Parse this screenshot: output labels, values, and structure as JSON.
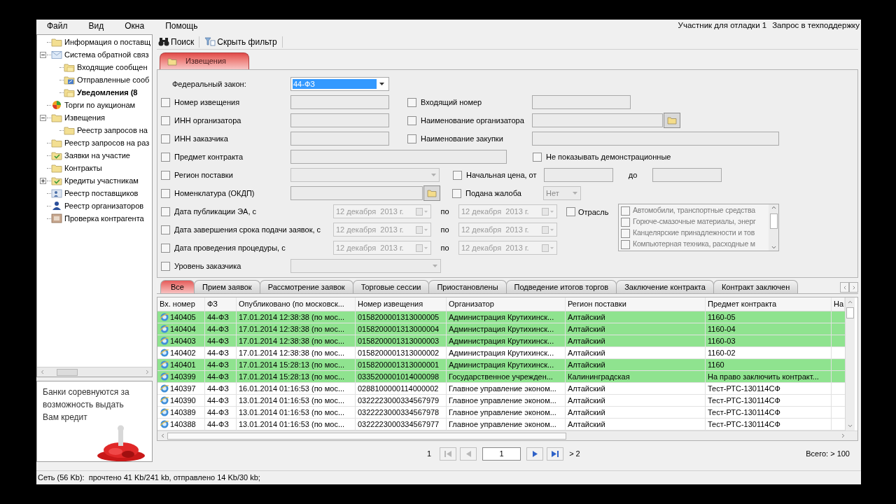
{
  "menu": [
    "Файл",
    "Вид",
    "Окна",
    "Помощь"
  ],
  "account": {
    "user": "Участник для отладки 1",
    "support": "Запрос в техподдержку"
  },
  "tree": [
    {
      "label": "Информация о поставщ",
      "kind": "folder",
      "bold": false
    },
    {
      "label": "Система обратной связ",
      "kind": "mail",
      "bold": false,
      "expanded": true,
      "children": [
        {
          "label": "Входящие сообщен",
          "kind": "mailbox",
          "bold": false
        },
        {
          "label": "Отправленные сооб",
          "kind": "outbox",
          "bold": false
        },
        {
          "label": "Уведомления (8",
          "kind": "mailbox",
          "bold": true
        }
      ]
    },
    {
      "label": "Торги по аукционам",
      "kind": "auction",
      "bold": false
    },
    {
      "label": "Извещения",
      "kind": "folder",
      "bold": false,
      "expanded": true,
      "children": [
        {
          "label": "Реестр запросов на",
          "kind": "folder",
          "bold": false
        }
      ]
    },
    {
      "label": "Реестр запросов на раз",
      "kind": "folder",
      "bold": false
    },
    {
      "label": "Заявки на участие",
      "kind": "application",
      "bold": false
    },
    {
      "label": "Контракты",
      "kind": "folder",
      "bold": false
    },
    {
      "label": "Кредиты участникам",
      "kind": "application",
      "bold": false,
      "expanded": false
    },
    {
      "label": "Реестр поставщиков",
      "kind": "suppliers",
      "bold": false
    },
    {
      "label": "Реестр организаторов",
      "kind": "organizers",
      "bold": false
    },
    {
      "label": "Проверка контрагента",
      "kind": "check",
      "bold": false
    }
  ],
  "ad": {
    "text": "Банки соревнуются за возможность выдать Вам кредит",
    "kind": "picture"
  },
  "toolbar": [
    "Поиск",
    "Скрыть фильтр"
  ],
  "document_tab": {
    "label": "Извещения",
    "selected": true
  },
  "filter": {
    "law": {
      "label": "Федеральный закон:",
      "value": "44-ФЗ"
    },
    "rows": [
      {
        "left": {
          "label": "Номер извещения",
          "checked": false,
          "kind": "text"
        },
        "right": {
          "label": "Входящий номер",
          "checked": false,
          "kind": "text"
        }
      },
      {
        "left": {
          "label": "ИНН организатора",
          "checked": false,
          "kind": "text"
        },
        "right": {
          "label": "Наименование организатора",
          "checked": false,
          "kind": "browse"
        }
      },
      {
        "left": {
          "label": "ИНН заказчика",
          "checked": false,
          "kind": "text"
        },
        "right": {
          "label": "Наименование закупки",
          "checked": false,
          "kind": "wide"
        }
      },
      {
        "left": {
          "label": "Предмет контракта",
          "checked": false,
          "kind": "wide"
        },
        "right": {
          "label": "Не показывать демонстрационные",
          "checked": false,
          "kind": "flag"
        }
      },
      {
        "left": {
          "label": "Регион поставки",
          "checked": false,
          "kind": "select"
        },
        "right": {
          "label": "Начальная цена, от",
          "checked": false,
          "kind": "range",
          "between": "до"
        }
      },
      {
        "left": {
          "label": "Номенклатура (ОКДП)",
          "checked": false,
          "kind": "browse"
        },
        "right": {
          "label": "Подана жалоба",
          "checked": false,
          "kind": "select",
          "value": "Нет"
        }
      }
    ],
    "dates": [
      {
        "label": "Дата публикации ЭА, с",
        "checked": false,
        "from": "12 декабря  2013 г.",
        "between": "по",
        "to": "12 декабря  2013 г."
      },
      {
        "label": "Дата завершения срока подачи заявок, с",
        "checked": false,
        "from": "12 декабря  2013 г.",
        "between": "по",
        "to": "12 декабря  2013 г."
      },
      {
        "label": "Дата проведения процедуры, с",
        "checked": false,
        "from": "12 декабря  2013 г.",
        "between": "по",
        "to": "12 декабря  2013 г."
      }
    ],
    "industry": {
      "label": "Отрасль",
      "checked": false,
      "options": [
        {
          "label": "Автомобили, транспортные средства",
          "checked": false
        },
        {
          "label": "Горюче-смазочные материалы, энерг",
          "checked": false
        },
        {
          "label": "Канцелярские принадлежности и тов",
          "checked": false
        },
        {
          "label": "Компьютерная техника, расходные м",
          "checked": false
        }
      ]
    },
    "customer_level": {
      "label": "Уровень заказчика",
      "checked": false
    }
  },
  "tabs": [
    {
      "label": "Все",
      "selected": true
    },
    {
      "label": "Прием заявок",
      "selected": false
    },
    {
      "label": "Рассмотрение заявок",
      "selected": false
    },
    {
      "label": "Торговые сессии",
      "selected": false
    },
    {
      "label": "Приостановлены",
      "selected": false
    },
    {
      "label": "Подведение итогов торгов",
      "selected": false
    },
    {
      "label": "Заключение контракта",
      "selected": false
    },
    {
      "label": "Контракт заключен",
      "selected": false
    }
  ],
  "table": {
    "columns": [
      "Вх. номер",
      "ФЗ",
      "Опубликовано (по московск...",
      "Номер извещения",
      "Организатор",
      "Регион поставки",
      "Предмет контракта",
      "На"
    ],
    "rows": [
      {
        "highlighted": true,
        "cells": [
          "140405",
          "44-ФЗ",
          "17.01.2014 12:38:38 (по мос...",
          "0158200001313000005",
          "Администрация Крутихинск...",
          "Алтайский",
          "1160-05"
        ]
      },
      {
        "highlighted": true,
        "cells": [
          "140404",
          "44-ФЗ",
          "17.01.2014 12:38:38 (по мос...",
          "0158200001313000004",
          "Администрация Крутихинск...",
          "Алтайский",
          "1160-04"
        ]
      },
      {
        "highlighted": true,
        "cells": [
          "140403",
          "44-ФЗ",
          "17.01.2014 12:38:38 (по мос...",
          "0158200001313000003",
          "Администрация Крутихинск...",
          "Алтайский",
          "1160-03"
        ]
      },
      {
        "highlighted": false,
        "cells": [
          "140402",
          "44-ФЗ",
          "17.01.2014 12:38:38 (по мос...",
          "0158200001313000002",
          "Администрация Крутихинск...",
          "Алтайский",
          "1160-02"
        ]
      },
      {
        "highlighted": true,
        "cells": [
          "140401",
          "44-ФЗ",
          "17.01.2014 15:28:13 (по мос...",
          "0158200001313000001",
          "Администрация Крутихинск...",
          "Алтайский",
          "1160"
        ]
      },
      {
        "highlighted": true,
        "cells": [
          "140399",
          "44-ФЗ",
          "17.01.2014 15:28:13 (по мос...",
          "0335200001014000098",
          "Государственное учрежден...",
          "Калининградская",
          "На право заключить контракт..."
        ]
      },
      {
        "highlighted": false,
        "cells": [
          "140397",
          "44-ФЗ",
          "16.01.2014 01:16:53 (по мос...",
          "0288100000114000002",
          "Главное управление эконом...",
          "Алтайский",
          "Тест-РТС-130114СФ"
        ]
      },
      {
        "highlighted": false,
        "cells": [
          "140390",
          "44-ФЗ",
          "13.01.2014 01:16:53 (по мос...",
          "0322223000334567979",
          "Главное управление эконом...",
          "Алтайский",
          "Тест-РТС-130114СФ"
        ]
      },
      {
        "highlighted": false,
        "cells": [
          "140389",
          "44-ФЗ",
          "13.01.2014 01:16:53 (по мос...",
          "0322223000334567978",
          "Главное управление эконом...",
          "Алтайский",
          "Тест-РТС-130114СФ"
        ]
      },
      {
        "highlighted": false,
        "cells": [
          "140388",
          "44-ФЗ",
          "13.01.2014 01:16:53 (по мос...",
          "0322223000334567977",
          "Главное управление эконом...",
          "Алтайский",
          "Тест-РТС-130114СФ"
        ]
      }
    ]
  },
  "pager": {
    "first": "1",
    "page": "1",
    "more": "> 2",
    "total": "Всего: > 100"
  },
  "status_bar": "Сеть (56 Kb):  прочтено 41 Kb/241 kb, отправлено 14 Kb/30 kb;"
}
